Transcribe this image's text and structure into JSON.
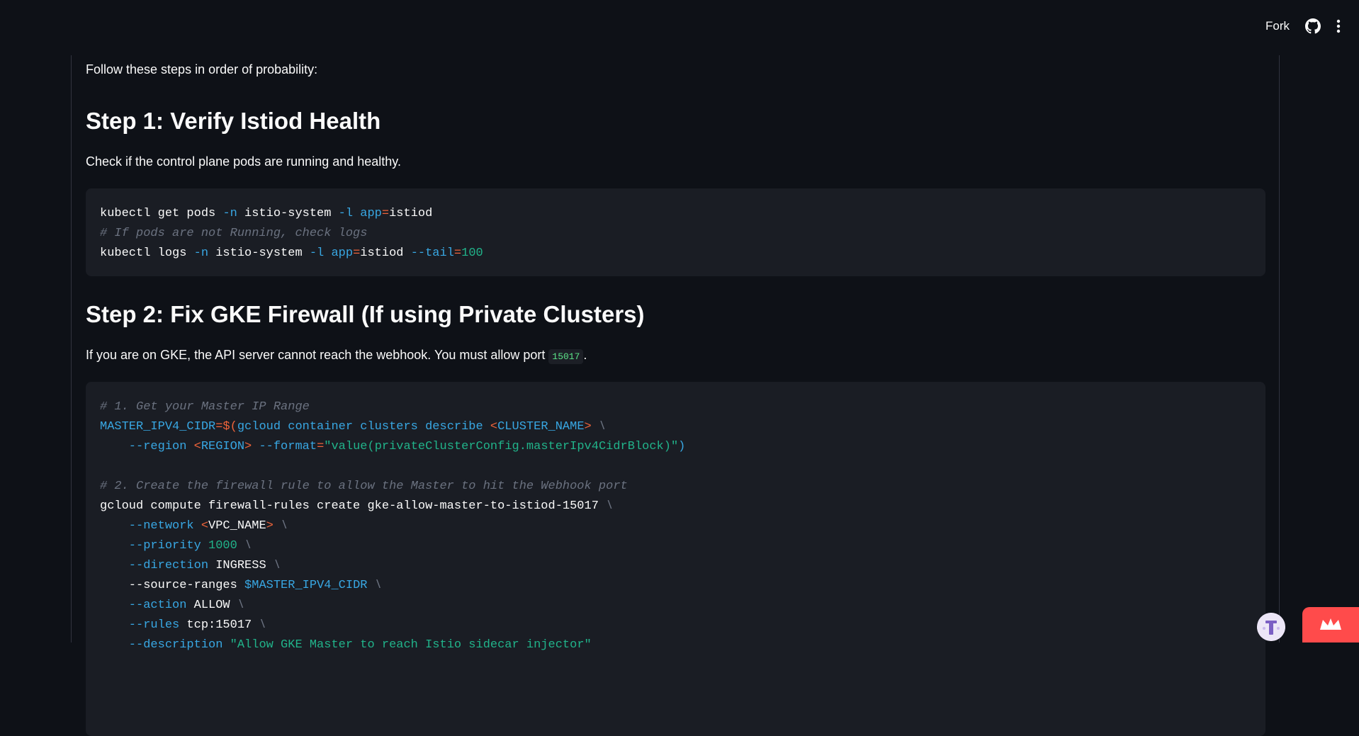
{
  "header": {
    "fork_label": "Fork",
    "icons": [
      "github-icon",
      "more-vertical-icon"
    ]
  },
  "intro": "Follow these steps in order of probability:",
  "step1": {
    "title": "Step 1: Verify Istiod Health",
    "description": "Check if the control plane pods are running and healthy.",
    "code": [
      [
        [
          "kubectl get pods ",
          ""
        ],
        [
          "-n",
          "flag"
        ],
        [
          " istio-system ",
          ""
        ],
        [
          "-l",
          "flag"
        ],
        [
          " ",
          ""
        ],
        [
          "app",
          "var"
        ],
        [
          "=",
          "op"
        ],
        [
          "istiod",
          ""
        ]
      ],
      [
        [
          "# If pods are not Running, check logs",
          "comment"
        ]
      ],
      [
        [
          "kubectl logs ",
          ""
        ],
        [
          "-n",
          "flag"
        ],
        [
          " istio-system ",
          ""
        ],
        [
          "-l",
          "flag"
        ],
        [
          " ",
          ""
        ],
        [
          "app",
          "var"
        ],
        [
          "=",
          "op"
        ],
        [
          "istiod ",
          ""
        ],
        [
          "--tail",
          "flag"
        ],
        [
          "=",
          "op"
        ],
        [
          "100",
          "num"
        ]
      ]
    ]
  },
  "step2": {
    "title": "Step 2: Fix GKE Firewall (If using Private Clusters)",
    "description_before": "If you are on GKE, the API server cannot reach the webhook. You must allow port ",
    "description_code": "15017",
    "description_after": ".",
    "code": [
      [
        [
          "# 1. Get your Master IP Range",
          "comment"
        ]
      ],
      [
        [
          "MASTER_IPV4_CIDR",
          "var"
        ],
        [
          "=$(",
          "op"
        ],
        [
          "gcloud container clusters describe ",
          "var"
        ],
        [
          "<",
          "op"
        ],
        [
          "CLUSTER_NAME",
          "var"
        ],
        [
          ">",
          "op"
        ],
        [
          " \\",
          "comment"
        ]
      ],
      [
        [
          "    --region ",
          "var"
        ],
        [
          "<",
          "op"
        ],
        [
          "REGION",
          "var"
        ],
        [
          ">",
          "op"
        ],
        [
          " --format",
          "var"
        ],
        [
          "=",
          "op"
        ],
        [
          "\"value(privateClusterConfig.masterIpv4CidrBlock)\"",
          "str"
        ],
        [
          ")",
          "var"
        ]
      ],
      [
        [
          "",
          ""
        ]
      ],
      [
        [
          "# 2. Create the firewall rule to allow the Master to hit the Webhook port",
          "comment"
        ]
      ],
      [
        [
          "gcloud compute firewall-rules create gke-allow-master-to-istiod-15017 ",
          ""
        ],
        [
          "\\",
          "comment"
        ]
      ],
      [
        [
          "    --network ",
          "flag"
        ],
        [
          "<",
          "op"
        ],
        [
          "VPC_NAME",
          ""
        ],
        [
          ">",
          "op"
        ],
        [
          " \\",
          "comment"
        ]
      ],
      [
        [
          "    --priority ",
          "flag"
        ],
        [
          "1000",
          "num"
        ],
        [
          " \\",
          "comment"
        ]
      ],
      [
        [
          "    --direction ",
          "flag"
        ],
        [
          "INGRESS",
          ""
        ],
        [
          " \\",
          "comment"
        ]
      ],
      [
        [
          "    --source-ranges ",
          ""
        ],
        [
          "$MASTER_IPV4_CIDR",
          "var"
        ],
        [
          " \\",
          "comment"
        ]
      ],
      [
        [
          "    --action ",
          "flag"
        ],
        [
          "ALLOW",
          ""
        ],
        [
          " \\",
          "comment"
        ]
      ],
      [
        [
          "    --rules ",
          "flag"
        ],
        [
          "tcp:15017",
          ""
        ],
        [
          " \\",
          "comment"
        ]
      ],
      [
        [
          "    --description ",
          "flag"
        ],
        [
          "\"Allow GKE Master to reach Istio sidecar injector\"",
          "str"
        ]
      ]
    ]
  },
  "colors": {
    "background": "#0e1117",
    "code_bg": "#1a1d24",
    "flag": "#38a7e3",
    "operator": "#f0643a",
    "number": "#21b38a",
    "comment": "#6b7280",
    "accent_red": "#ff4b4b"
  }
}
